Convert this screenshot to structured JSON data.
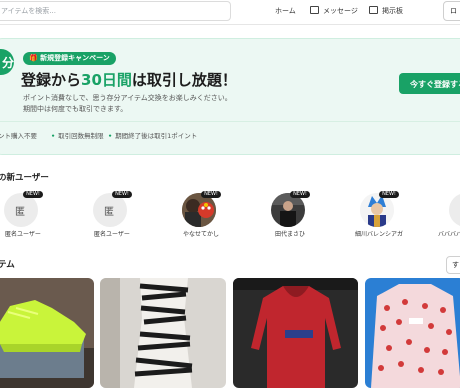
{
  "header": {
    "search_placeholder": "アイテムを検索...",
    "nav": [
      "ホーム",
      "メッセージ",
      "掲示板"
    ],
    "login": "ロ"
  },
  "hero": {
    "circle_char": "分",
    "campaign_badge": "🎁 新規登録キャンペーン",
    "headline_pre": "登録から",
    "headline_highlight": "30日間",
    "headline_post": "は取引し放題！",
    "desc_line1": "ポイント消費なしで、思う存分アイテム交換をお楽しみください。",
    "desc_line2": "期間中は何度でも取引できます。",
    "cta": "今すぐ登録する",
    "features": [
      "ント購入不要",
      "取引回数無制限",
      "期間終了後は取引1ポイント"
    ]
  },
  "new_users": {
    "title": "の新ユーザー",
    "badge": "NEW!",
    "anon_char": "匿",
    "users": [
      {
        "name": "匿名ユーザー"
      },
      {
        "name": "匿名ユーザー"
      },
      {
        "name": "やなせてかし"
      },
      {
        "name": "田代まさひ"
      },
      {
        "name": "細川バレンシアガ"
      },
      {
        "name": "バババババ"
      }
    ]
  },
  "items": {
    "title": "テム",
    "sort_label": "す"
  },
  "colors": {
    "accent": "#19a266",
    "hero_bg": "#ecf8f3"
  }
}
